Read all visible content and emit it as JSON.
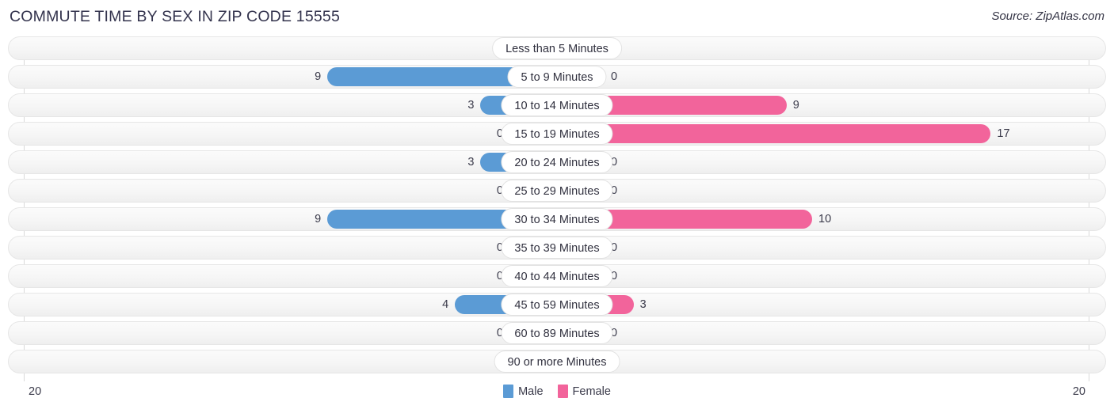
{
  "header": {
    "title": "COMMUTE TIME BY SEX IN ZIP CODE 15555",
    "source": "Source: ZipAtlas.com"
  },
  "legend": {
    "items": [
      {
        "label": "Male",
        "color": "#5b9bd5"
      },
      {
        "label": "Female",
        "color": "#f2649b"
      }
    ]
  },
  "axis": {
    "left_tick": "20",
    "right_tick": "20",
    "max": 20
  },
  "colors": {
    "male_strong": "#5b9bd5",
    "male_light": "#aecbe9",
    "female_strong": "#f2649b",
    "female_light": "#f9a8c5",
    "track": "#f6f6f6",
    "title": "#33334d"
  },
  "chart_data": {
    "type": "bar",
    "title": "COMMUTE TIME BY SEX IN ZIP CODE 15555",
    "subtitle": "Source: ZipAtlas.com",
    "orientation": "horizontal-diverging",
    "xlabel": "",
    "ylabel": "",
    "xlim": [
      -20,
      20
    ],
    "grid": false,
    "legend_position": "bottom-center",
    "categories": [
      "Less than 5 Minutes",
      "5 to 9 Minutes",
      "10 to 14 Minutes",
      "15 to 19 Minutes",
      "20 to 24 Minutes",
      "25 to 29 Minutes",
      "30 to 34 Minutes",
      "35 to 39 Minutes",
      "40 to 44 Minutes",
      "45 to 59 Minutes",
      "60 to 89 Minutes",
      "90 or more Minutes"
    ],
    "series": [
      {
        "name": "Male",
        "values": [
          0,
          9,
          3,
          0,
          3,
          0,
          9,
          0,
          0,
          4,
          0,
          0
        ]
      },
      {
        "name": "Female",
        "values": [
          0,
          0,
          9,
          17,
          0,
          0,
          10,
          0,
          0,
          3,
          0,
          0
        ]
      }
    ],
    "rows": [
      {
        "category": "Less than 5 Minutes",
        "male": 0,
        "male_label": "0",
        "female": 0,
        "female_label": "0"
      },
      {
        "category": "5 to 9 Minutes",
        "male": 9,
        "male_label": "9",
        "female": 0,
        "female_label": "0"
      },
      {
        "category": "10 to 14 Minutes",
        "male": 3,
        "male_label": "3",
        "female": 9,
        "female_label": "9"
      },
      {
        "category": "15 to 19 Minutes",
        "male": 0,
        "male_label": "0",
        "female": 17,
        "female_label": "17"
      },
      {
        "category": "20 to 24 Minutes",
        "male": 3,
        "male_label": "3",
        "female": 0,
        "female_label": "0"
      },
      {
        "category": "25 to 29 Minutes",
        "male": 0,
        "male_label": "0",
        "female": 0,
        "female_label": "0"
      },
      {
        "category": "30 to 34 Minutes",
        "male": 9,
        "male_label": "9",
        "female": 10,
        "female_label": "10"
      },
      {
        "category": "35 to 39 Minutes",
        "male": 0,
        "male_label": "0",
        "female": 0,
        "female_label": "0"
      },
      {
        "category": "40 to 44 Minutes",
        "male": 0,
        "male_label": "0",
        "female": 0,
        "female_label": "0"
      },
      {
        "category": "45 to 59 Minutes",
        "male": 4,
        "male_label": "4",
        "female": 3,
        "female_label": "3"
      },
      {
        "category": "60 to 89 Minutes",
        "male": 0,
        "male_label": "0",
        "female": 0,
        "female_label": "0"
      },
      {
        "category": "90 or more Minutes",
        "male": 0,
        "male_label": "0",
        "female": 0,
        "female_label": "0"
      }
    ]
  }
}
